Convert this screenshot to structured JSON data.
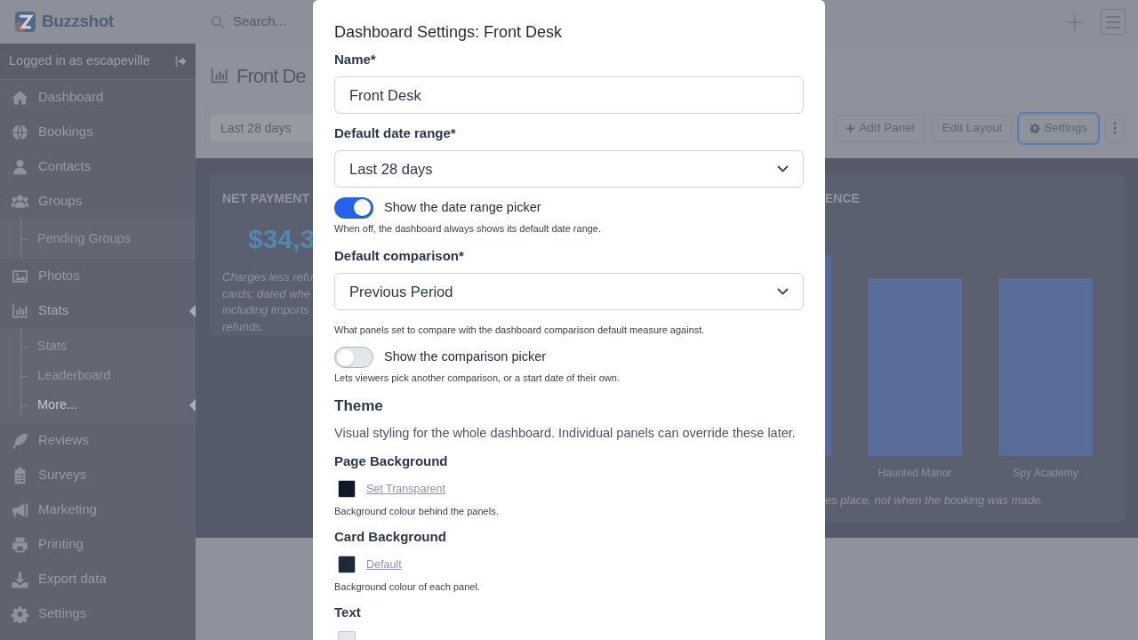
{
  "topbar": {
    "brand": "Buzzshot",
    "search": {
      "placeholder": "Search..."
    }
  },
  "sidebar": {
    "user_text": "Logged in as escapeville",
    "items": [
      {
        "label": "Dashboard",
        "selected": false
      },
      {
        "label": "Bookings",
        "selected": false
      },
      {
        "label": "Contacts",
        "selected": false
      },
      {
        "label": "Groups",
        "selected": false,
        "children": [
          {
            "label": "Pending Groups",
            "selected": false
          }
        ]
      },
      {
        "label": "Photos",
        "selected": false
      },
      {
        "label": "Stats",
        "selected": true,
        "children": [
          {
            "label": "Stats",
            "selected": false
          },
          {
            "label": "Leaderboard",
            "selected": false
          },
          {
            "label": "More...",
            "selected": true
          }
        ]
      },
      {
        "label": "Reviews",
        "selected": false
      },
      {
        "label": "Surveys",
        "selected": false
      },
      {
        "label": "Marketing",
        "selected": false
      },
      {
        "label": "Printing",
        "selected": false
      },
      {
        "label": "Export data",
        "selected": false
      },
      {
        "label": "Settings",
        "selected": false
      }
    ]
  },
  "page": {
    "title": "Front De",
    "date_range": "Last 28 days",
    "buttons": [
      {
        "label": "Add Panel",
        "kind": "add",
        "focused": false
      },
      {
        "label": "Edit Layout",
        "kind": "plain",
        "focused": false
      },
      {
        "label": "Settings",
        "kind": "settings",
        "focused": true
      }
    ]
  },
  "cards": [
    {
      "title": "NET PAYMENT",
      "value": "$34,3",
      "description": [
        "Charges less refu",
        "cards; dated whe",
        "including imports",
        "refunds."
      ]
    },
    {
      "title": "ENCE",
      "bar_labels": [
        "Haunted Manor",
        "Spy Academy"
      ],
      "footer": "es place, not when the booking was made."
    }
  ],
  "modal": {
    "title": "Dashboard Settings: Front Desk",
    "fields": [
      {
        "kind": "text",
        "label": "Name*",
        "value": "Front Desk"
      },
      {
        "kind": "select",
        "label": "Default date range*",
        "value": "Last 28 days"
      },
      {
        "kind": "toggle",
        "label": "Show the date range picker",
        "on": true,
        "hint": "When off, the dashboard always shows its default date range."
      },
      {
        "kind": "select",
        "label": "Default comparison*",
        "value": "Previous Period",
        "hint": "What panels set to compare with the dashboard comparison default measure against."
      },
      {
        "kind": "toggle",
        "label": "Show the comparison picker",
        "on": false,
        "hint": "Lets viewers pick another comparison, or a start date of their own."
      }
    ],
    "theme": {
      "heading": "Theme",
      "description": "Visual styling for the whole dashboard. Individual panels can override these later.",
      "colors": [
        {
          "label": "Page Background",
          "color": "#111827",
          "link": "Set Transparent",
          "hint": "Background colour behind the panels."
        },
        {
          "label": "Card Background",
          "color": "#1f2937",
          "link": "Default",
          "hint": "Background colour of each panel."
        },
        {
          "label": "Text",
          "color": "#e5e7eb"
        }
      ]
    }
  }
}
